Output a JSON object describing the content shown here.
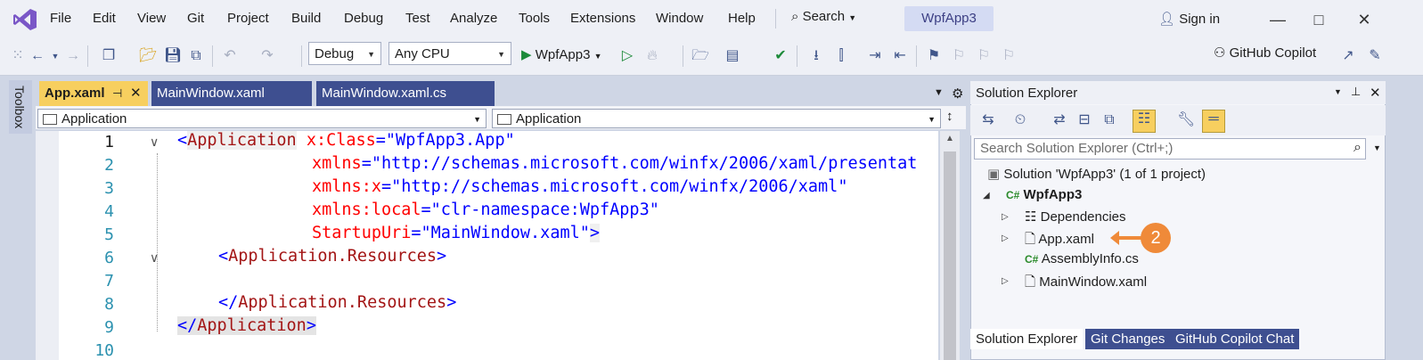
{
  "menu": {
    "items": [
      "File",
      "Edit",
      "View",
      "Git",
      "Project",
      "Build",
      "Debug",
      "Test",
      "Analyze",
      "Tools",
      "Extensions",
      "Window",
      "Help"
    ],
    "search_label": "Search",
    "project_name": "WpfApp3",
    "signin_label": "Sign in"
  },
  "toolbar": {
    "config_value": "Debug",
    "platform_value": "Any CPU",
    "run_label": "WpfApp3",
    "copilot_label": "GitHub Copilot"
  },
  "toolbox": {
    "label": "Toolbox"
  },
  "editor": {
    "tabs": [
      "App.xaml",
      "MainWindow.xaml",
      "MainWindow.xaml.cs"
    ],
    "nav_left": "Application",
    "nav_right": "Application",
    "line_numbers": [
      "1",
      "2",
      "3",
      "4",
      "5",
      "6",
      "7",
      "8",
      "9",
      "10"
    ]
  },
  "code": {
    "l1_open": "<",
    "l1_tag": "Application",
    "l1_attr": "x:Class",
    "l1_eq": "=",
    "l1_val": "\"WpfApp3.App\"",
    "l2_attr": "xmlns",
    "l2_eq": "=",
    "l2_val": "\"http://schemas.microsoft.com/winfx/2006/xaml/presentat",
    "l3_attr": "xmlns:x",
    "l3_eq": "=",
    "l3_val": "\"http://schemas.microsoft.com/winfx/2006/xaml\"",
    "l4_attr": "xmlns:local",
    "l4_eq": "=",
    "l4_val": "\"clr-namespace:WpfApp3\"",
    "l5_attr": "StartupUri",
    "l5_eq": "=",
    "l5_val": "\"MainWindow.xaml\"",
    "l5_close": ">",
    "l6_open": "<",
    "l6_tag": "Application.Resources",
    "l6_close": ">",
    "l8_open": "</",
    "l8_tag": "Application.Resources",
    "l8_close": ">",
    "l9_open": "</",
    "l9_tag": "Application",
    "l9_close": ">"
  },
  "solution_explorer": {
    "title": "Solution Explorer",
    "search_placeholder": "Search Solution Explorer (Ctrl+;)",
    "solution": "Solution 'WpfApp3' (1 of 1 project)",
    "project": "WpfApp3",
    "items": [
      "Dependencies",
      "App.xaml",
      "AssemblyInfo.cs",
      "MainWindow.xaml"
    ],
    "callout_number": "2",
    "bottom_tabs": [
      "Solution Explorer",
      "Git Changes",
      "GitHub Copilot Chat"
    ]
  },
  "colors": {
    "accent_yellow": "#f7cf5f",
    "tab_blue": "#3e4f90",
    "callout_orange": "#ef8a39",
    "xml_tag": "#a31515",
    "xml_attr": "#ff0000",
    "xml_value": "#0000ff"
  },
  "icons": [
    "vs-logo-icon",
    "search-icon",
    "sign-in-icon",
    "minimize-icon",
    "maximize-icon",
    "close-icon",
    "back-icon",
    "forward-icon",
    "new-project-icon",
    "open-icon",
    "save-icon",
    "save-all-icon",
    "undo-icon",
    "redo-icon",
    "run-icon",
    "run-without-debug-icon",
    "hot-reload-icon",
    "pin-icon",
    "tab-close-icon",
    "gear-icon",
    "solution-icon",
    "csharp-project-icon",
    "dependencies-icon",
    "xaml-file-icon",
    "csharp-file-icon"
  ]
}
